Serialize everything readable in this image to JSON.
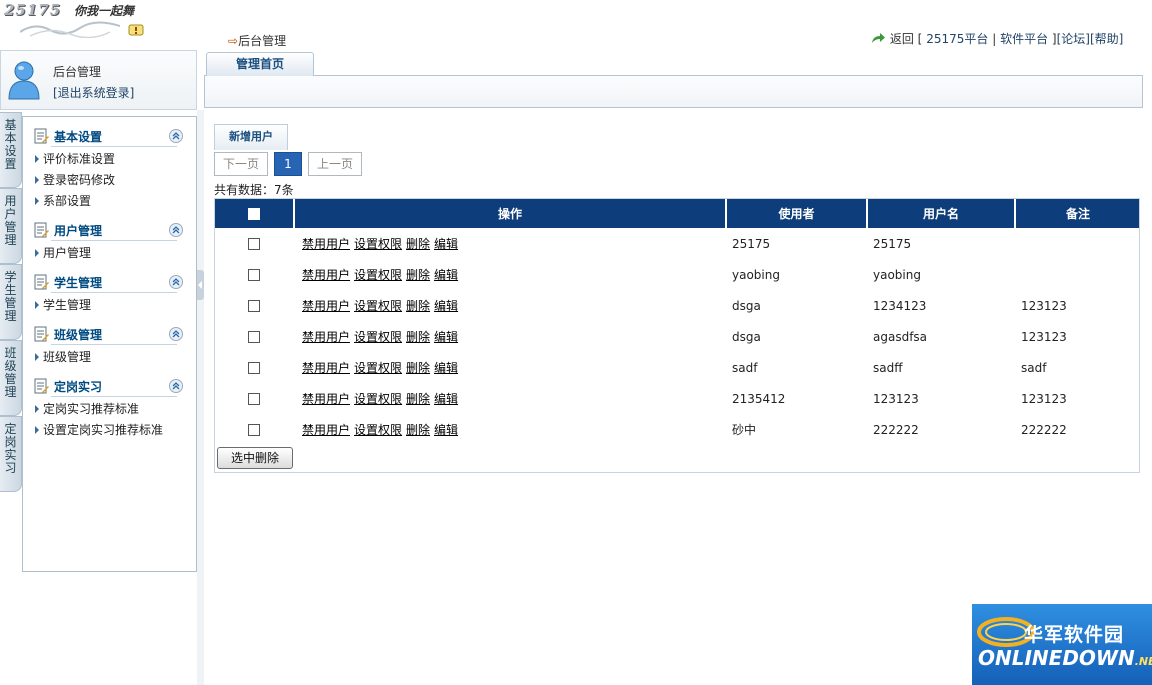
{
  "header": {
    "logo_text": "25175",
    "logo_slogan": "你我一起舞",
    "breadcrumb": "后台管理",
    "links": {
      "return_label": "返回",
      "bracket_open": "[",
      "platform_25175": "25175平台",
      "sep": "|",
      "software_platform": "软件平台",
      "bracket_close": "]",
      "forum": "[论坛]",
      "help": "[帮助]"
    }
  },
  "user": {
    "name": "后台管理",
    "logout": "[退出系统登录]"
  },
  "vtabs": [
    "基本设置",
    "用户管理",
    "学生管理",
    "班级管理",
    "定岗实习"
  ],
  "menu": {
    "groups": [
      {
        "title": "基本设置",
        "items": [
          "评价标准设置",
          "登录密码修改",
          "系部设置"
        ]
      },
      {
        "title": "用户管理",
        "items": [
          "用户管理"
        ]
      },
      {
        "title": "学生管理",
        "items": [
          "学生管理"
        ]
      },
      {
        "title": "班级管理",
        "items": [
          "班级管理"
        ]
      },
      {
        "title": "定岗实习",
        "items": [
          "定岗实习推荐标准",
          "设置定岗实习推荐标准"
        ]
      }
    ]
  },
  "main": {
    "tab": "管理首页",
    "add_user_tab": "新增用户",
    "pager": {
      "next": "下一页",
      "current": "1",
      "prev": "上一页"
    },
    "total": "共有数据：7条",
    "table": {
      "headers": {
        "ops": "操作",
        "user": "使用者",
        "username": "用户名",
        "note": "备注"
      },
      "ops": {
        "disable": "禁用用户",
        "perm": "设置权限",
        "delete": "删除",
        "edit": "编辑"
      },
      "rows": [
        {
          "user": "25175",
          "username": "25175",
          "note": ""
        },
        {
          "user": "yaobing",
          "username": "yaobing",
          "note": ""
        },
        {
          "user": "dsga",
          "username": "1234123",
          "note": "123123"
        },
        {
          "user": "dsga",
          "username": "agasdfsa",
          "note": "123123"
        },
        {
          "user": "sadf",
          "username": "sadff",
          "note": "sadf"
        },
        {
          "user": "2135412",
          "username": "123123",
          "note": "123123"
        },
        {
          "user": "砂中",
          "username": "222222",
          "note": "222222"
        }
      ]
    },
    "delete_selected": "选中删除"
  },
  "watermark": {
    "cn": "华军软件园",
    "en": "ONLINEDOWN",
    "net": ".NET"
  },
  "colors": {
    "header_blue": "#0d3d7a",
    "accent": "#2764b3"
  }
}
